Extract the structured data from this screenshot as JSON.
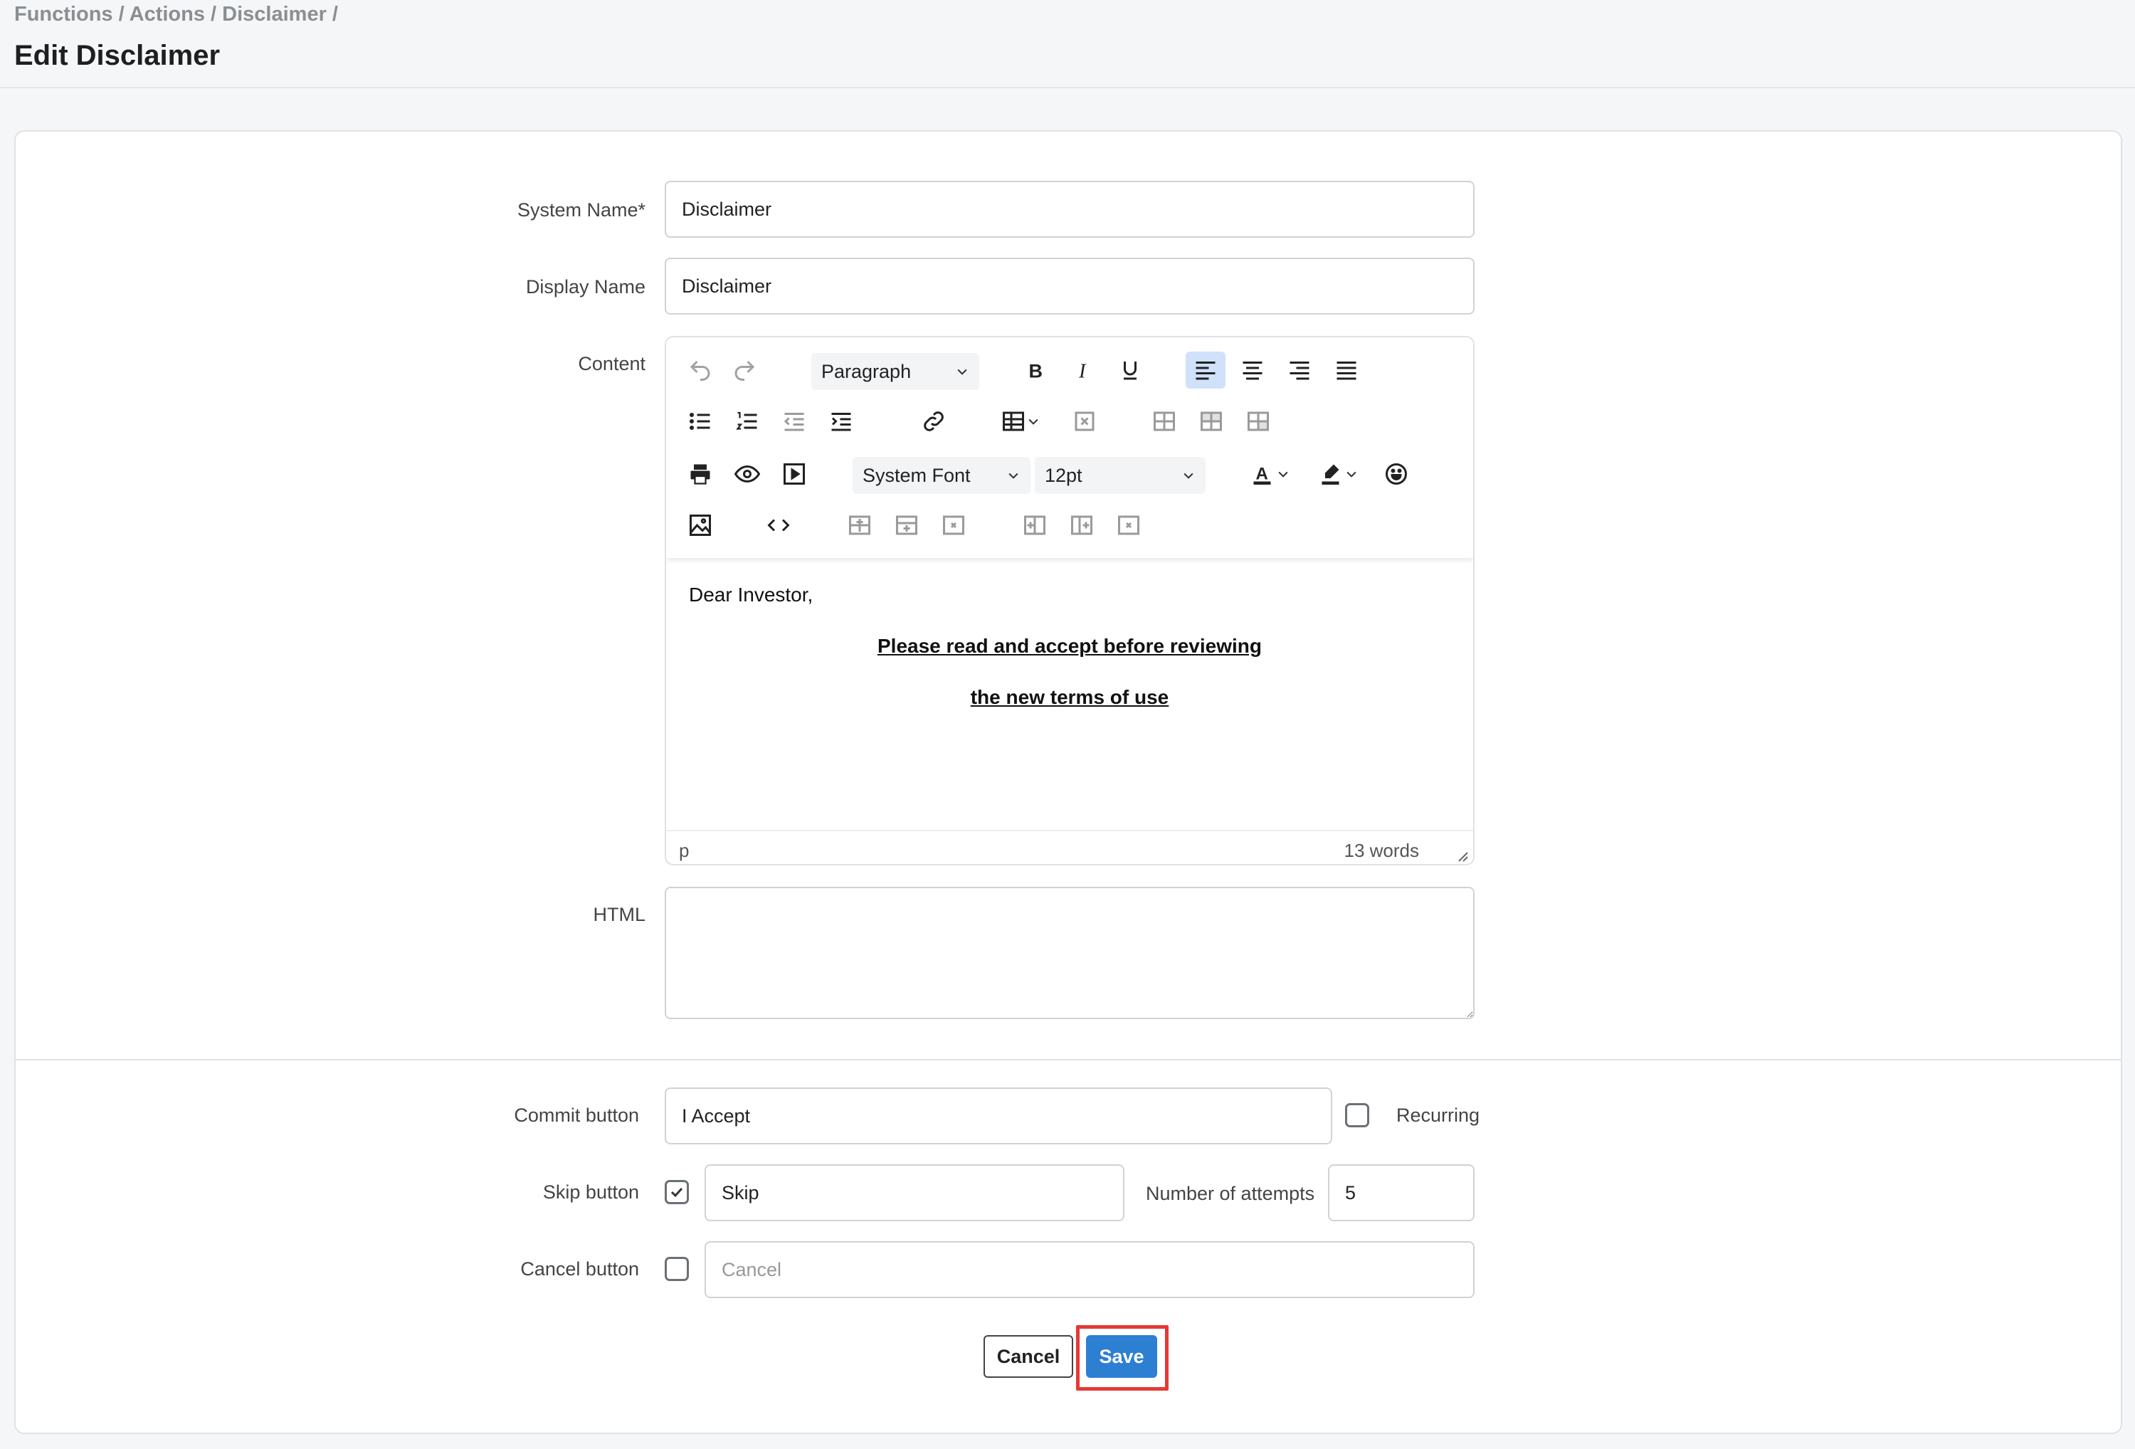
{
  "breadcrumb": "Functions / Actions / Disclaimer /",
  "page_title": "Edit Disclaimer",
  "form": {
    "system_name": {
      "label": "System Name*",
      "value": "Disclaimer"
    },
    "display_name": {
      "label": "Display Name",
      "value": "Disclaimer"
    },
    "content": {
      "label": "Content",
      "toolbar": {
        "block_format": "Paragraph",
        "font_family": "System Font",
        "font_size": "12pt"
      },
      "body": {
        "greeting": "Dear Investor,",
        "heading_line1": "Please read and accept before reviewing",
        "heading_line2": "the new terms of use"
      },
      "status_path": "p",
      "word_count": "13 words"
    },
    "html": {
      "label": "HTML",
      "value": ""
    },
    "commit_button": {
      "label": "Commit button",
      "value": "I Accept"
    },
    "recurring": {
      "label": "Recurring",
      "checked": false
    },
    "skip_button": {
      "label": "Skip button",
      "checked": true,
      "value": "Skip"
    },
    "attempts": {
      "label": "Number of attempts",
      "value": "5"
    },
    "cancel_button": {
      "label": "Cancel button",
      "checked": false,
      "placeholder": "Cancel"
    }
  },
  "actions": {
    "cancel": "Cancel",
    "save": "Save"
  },
  "colors": {
    "primary": "#2d7fd2",
    "highlight": "#e53935",
    "active_tool": "#cfe1fb"
  }
}
